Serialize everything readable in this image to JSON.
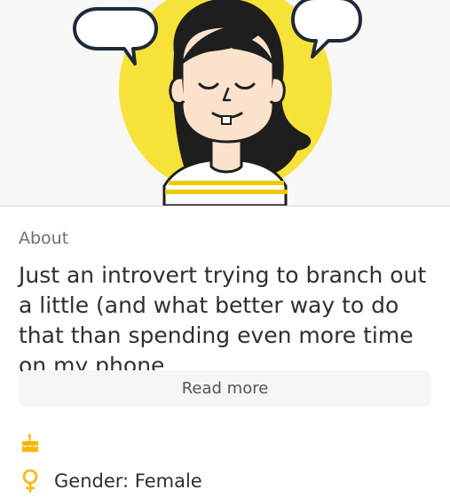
{
  "colors": {
    "accent": "#ffb400",
    "avatar_bg": "#f7e23a",
    "hair": "#1e1e1e"
  },
  "profile": {
    "about_label": "About",
    "bio": "Just an introvert trying to branch out a little (and what better way to do that than spending even more time on my phone,",
    "read_more_label": "Read more",
    "birthday_icon": "birthday-cake-icon",
    "gender_icon": "female-symbol-icon",
    "gender_text": "Gender: Female"
  }
}
